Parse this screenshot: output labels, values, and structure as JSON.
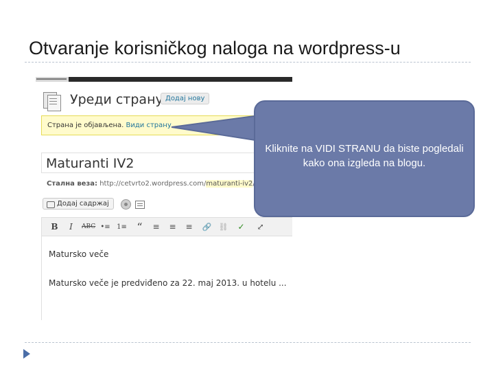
{
  "slide": {
    "title": "Otvaranje korisničkog naloga na wordpress-u"
  },
  "editor_screenshot": {
    "heading": "Уреди страну",
    "add_new_label": "Додај нову",
    "notice_text": "Страна је објављена.",
    "notice_link": "Види страну",
    "post_title": "Maturanti IV2",
    "permalink_label": "Стална веза:",
    "permalink_url": "http://cetvrto2.wordpress.com/",
    "permalink_slug": "maturanti-iv2",
    "permalink_end": "/",
    "add_media_label": "Додај садржај",
    "toolbar_buttons": [
      "B",
      "I",
      "ABC",
      "•≡",
      "1≡",
      "“",
      "≡",
      "≡",
      "≡",
      "🔗",
      "⛓",
      "✓",
      "⤢"
    ],
    "content_lines": [
      "Matursko veče",
      "Matursko veče je predviđeno za 22. maj 2013. u hotelu ..."
    ]
  },
  "callout": {
    "text": "Kliknite na VIDI STRANU da biste pogledali kako ona izgleda na blogu.",
    "fill_color": "#6b7aa8"
  },
  "colors": {
    "notice_bg": "#fffbcc",
    "link": "#21759b",
    "bullet": "#4b6ea8"
  }
}
